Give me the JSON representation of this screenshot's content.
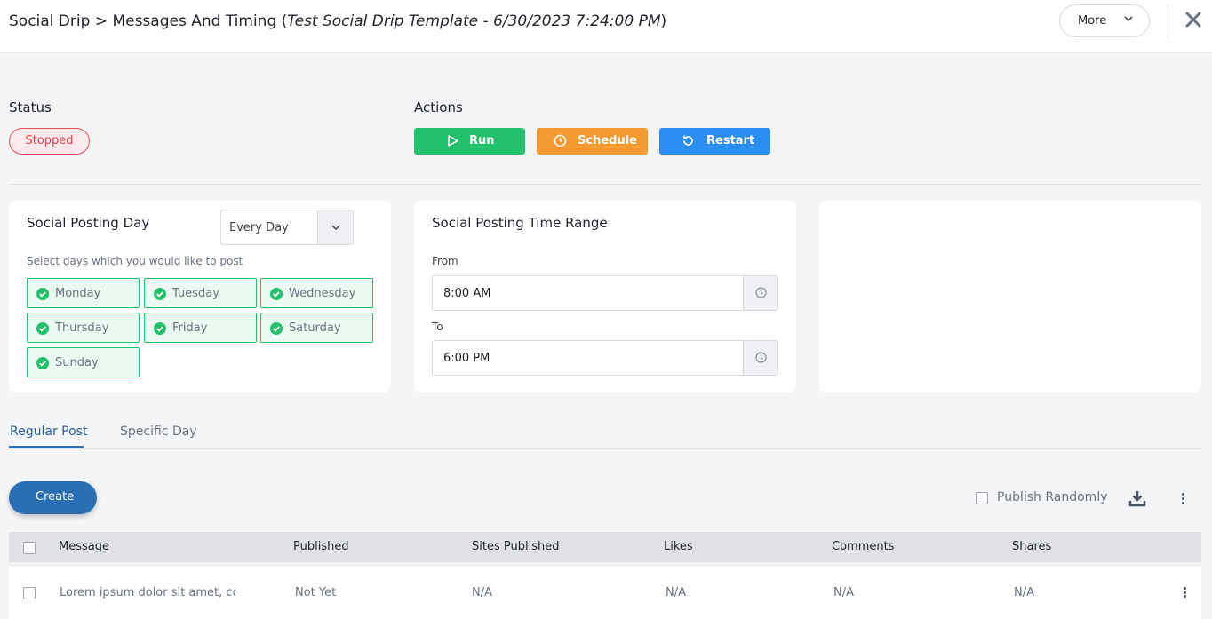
{
  "header": {
    "breadcrumb": "Social Drip > Messages And Timing (",
    "template_name": "Test Social Drip Template - 6/30/2023 7:24:00 PM",
    "breadcrumb_close": ")",
    "more_label": "More"
  },
  "status": {
    "label": "Status",
    "value": "Stopped"
  },
  "actions": {
    "label": "Actions",
    "run": "Run",
    "schedule": "Schedule",
    "restart": "Restart"
  },
  "posting_day": {
    "title": "Social Posting Day",
    "select_value": "Every Day",
    "hint": "Select days which you would like to post",
    "days": [
      "Monday",
      "Tuesday",
      "Wednesday",
      "Thursday",
      "Friday",
      "Saturday",
      "Sunday"
    ]
  },
  "time_range": {
    "title": "Social Posting Time Range",
    "from_label": "From",
    "from_value": "8:00 AM",
    "to_label": "To",
    "to_value": "6:00 PM"
  },
  "tabs": {
    "regular": "Regular Post",
    "specific": "Specific Day"
  },
  "toolbar": {
    "create": "Create",
    "publish_randomly": "Publish Randomly"
  },
  "table": {
    "columns": [
      "Message",
      "Published",
      "Sites Published",
      "Likes",
      "Comments",
      "Shares"
    ],
    "rows": [
      {
        "message": "Lorem ipsum dolor sit amet, consectetur",
        "published": "Not Yet",
        "sites": "N/A",
        "likes": "N/A",
        "comments": "N/A",
        "shares": "N/A"
      }
    ]
  },
  "colors": {
    "success": "#23c16b",
    "warning": "#f49a32",
    "primary": "#2a8df2",
    "danger": "#e2434d",
    "brand": "#2a6fb4"
  }
}
